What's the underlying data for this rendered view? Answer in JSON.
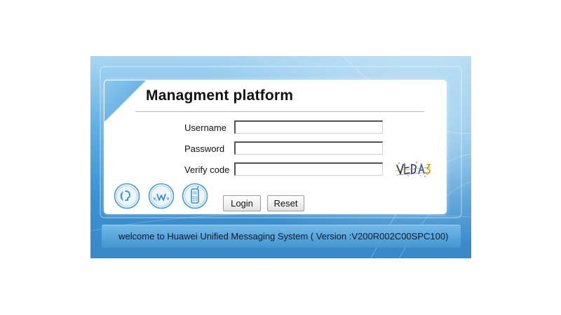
{
  "window": {
    "title": "Managment platform"
  },
  "form": {
    "username_label": "Username",
    "password_label": "Password",
    "verify_label": "Verify code",
    "username_value": "",
    "password_value": "",
    "verify_value": ""
  },
  "buttons": {
    "login_label": "Login",
    "reset_label": "Reset"
  },
  "footer": {
    "text": "welcome to Huawei Unified Messaging System  ( Version :V200R002C00SPC100)"
  },
  "icons": [
    "voice-icon",
    "web-icon",
    "mobile-phone-icon"
  ],
  "colors": {
    "frame_blue": "#3a92d2",
    "card_bg": "#ffffff",
    "icon_blue": "#3a8fd0"
  }
}
